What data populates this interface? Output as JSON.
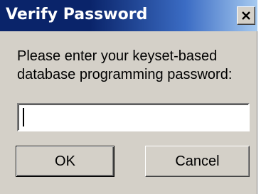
{
  "dialog": {
    "title": "Verify Password",
    "close_icon": "close-icon",
    "prompt_line1": "Please enter your keyset-based",
    "prompt_line2": "database programming password:",
    "password_value": "",
    "ok_label": "OK",
    "cancel_label": "Cancel"
  },
  "colors": {
    "titlebar_start": "#0a246a",
    "titlebar_end": "#a6caf0",
    "dialog_face": "#d4d0c8",
    "title_text": "#ffffff"
  }
}
